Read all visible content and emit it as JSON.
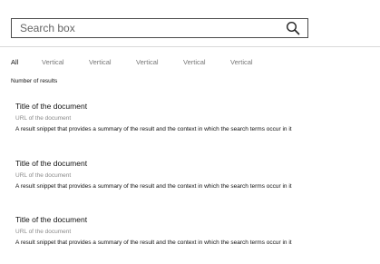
{
  "search": {
    "placeholder": "Search box"
  },
  "tabs": [
    "All",
    "Vertical",
    "Vertical",
    "Vertical",
    "Vertical",
    "Vertical"
  ],
  "results_count_label": "Number of results",
  "results": [
    {
      "title": "Title of the document",
      "url": "URL of the document",
      "snippet": "A result snippet that provides a summary of the result and the context in which the search terms occur in it"
    },
    {
      "title": "Title of the document",
      "url": "URL of the document",
      "snippet": "A result snippet that provides a summary of the result and the context in which the search terms occur in it"
    },
    {
      "title": "Title of the document",
      "url": "URL of the document",
      "snippet": "A result snippet that provides a summary of the result and the context in which the search terms occur in it"
    }
  ]
}
